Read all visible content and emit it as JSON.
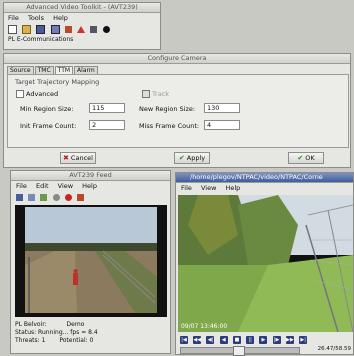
{
  "toolkit": {
    "title": "Advanced Video Toolkit - (AVT239)",
    "menu": [
      "File",
      "Tools",
      "Help"
    ],
    "company": "PL E-Communications"
  },
  "camera": {
    "title": "Configure Camera",
    "tabs": [
      "Source",
      "TMC",
      "TTM",
      "Alarm"
    ],
    "section": "Target Trajectory Mapping",
    "advanced_label": "Advanced",
    "track_label": "Track",
    "min_region_label": "Min Region Size:",
    "min_region_value": "115",
    "new_region_label": "New Region Size:",
    "new_region_value": "130",
    "init_frame_label": "Init Frame Count:",
    "init_frame_value": "2",
    "miss_frame_label": "Miss Frame Count:",
    "miss_frame_value": "4",
    "cancel_label": "Cancel",
    "apply_label": "Apply",
    "ok_label": "OK"
  },
  "feed": {
    "title": "AVT239 Feed",
    "menu": [
      "File",
      "Edit",
      "View",
      "Help"
    ],
    "status1_label": "PL Belvoir:",
    "status1_value": "Demo",
    "status2": "Status: Running... fps = 8.4",
    "status3_label": "Threats: 1",
    "status3_value": "Potential: 0"
  },
  "player": {
    "title": "/home/plegov/NTPAC/video/NTPAC/Corne",
    "menu": [
      "File",
      "View",
      "Help"
    ],
    "timestamp": "09/07 13:46:00",
    "timecode": "26.47/58.59"
  },
  "colors": {
    "accent": "#3f5c9d",
    "cancel_icon": "#b02020",
    "ok_icon": "#2d8a2d"
  }
}
